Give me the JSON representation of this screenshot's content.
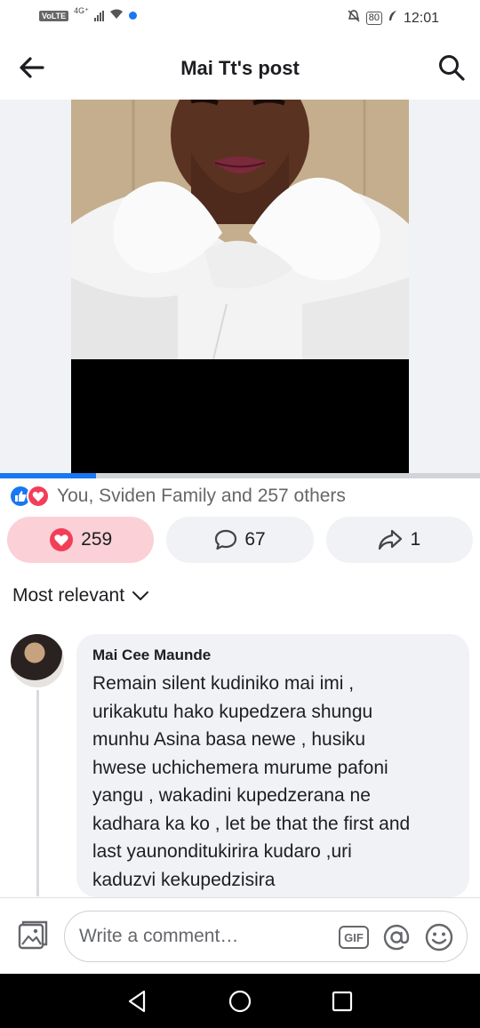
{
  "status_bar": {
    "network_badge": "VoLTE",
    "network_type": "4G⁺",
    "battery": "80",
    "time": "12:01"
  },
  "header": {
    "title": "Mai Tt's post",
    "back_icon": "arrow-left-icon",
    "search_icon": "search-icon"
  },
  "media": {
    "progress": 0.2,
    "colors": {
      "progress_fill": "#1877f2",
      "progress_track": "#d0d3d8"
    }
  },
  "reactions": {
    "summary": "You, Sviden Family and 257 others",
    "icons": [
      "like-icon",
      "love-icon"
    ]
  },
  "actions": {
    "reaction_count": "259",
    "comment_count": "67",
    "share_count": "1",
    "colors": {
      "reaction_active_bg": "#fbd0d7",
      "love": "#f33e58"
    }
  },
  "filter": {
    "label": "Most relevant"
  },
  "comment": {
    "author": "Mai Cee Maunde",
    "text": "Remain silent kudiniko mai imi ,\nurikakutu hako kupedzera shungu\nmunhu Asina basa newe , husiku\nhwese uchichemera murume pafoni\nyangu , wakadini kupedzerana ne\nkadhara ka ko , let be that the first and\nlast yaunonditukirira kudaro ,uri\nkaduzvi kekupedzisira"
  },
  "composer": {
    "placeholder": "Write a comment…",
    "gif_label": "GIF"
  },
  "colors": {
    "brand": "#1877f2",
    "surface": "#f0f2f5",
    "text_secondary": "#65676b"
  }
}
